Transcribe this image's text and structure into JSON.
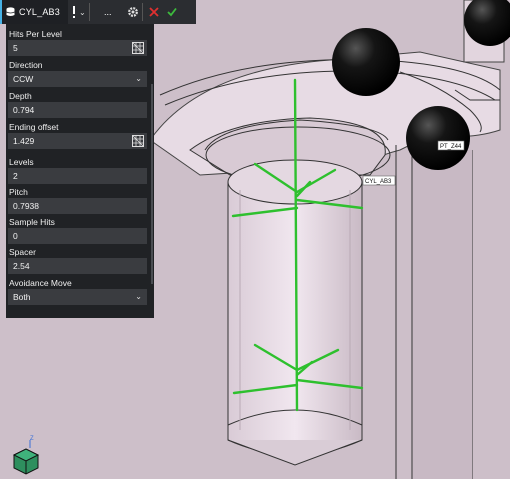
{
  "toolbar": {
    "feature_name": "CYL_AB3",
    "more_label": "...",
    "icons": [
      "database-icon",
      "exclamation-icon",
      "chevron-down-icon",
      "gear-icon",
      "close-icon",
      "check-icon"
    ],
    "colors": {
      "accent": "#47b2e6",
      "cancel": "#e03030",
      "confirm": "#3dbb3d"
    }
  },
  "panel": {
    "fields": [
      {
        "label": "Hits Per Level",
        "value": "5",
        "kind": "input-picker"
      },
      {
        "label": "Direction",
        "value": "CCW",
        "kind": "select"
      },
      {
        "label": "Depth",
        "value": "0.794",
        "kind": "input"
      },
      {
        "label": "Ending offset",
        "value": "1.429",
        "kind": "input-picker"
      },
      {
        "label": "Levels",
        "value": "2",
        "kind": "input"
      },
      {
        "label": "Pitch",
        "value": "0.7938",
        "kind": "input"
      },
      {
        "label": "Sample Hits",
        "value": "0",
        "kind": "input"
      },
      {
        "label": "Spacer",
        "value": "2.54",
        "kind": "input"
      },
      {
        "label": "Avoidance Move",
        "value": "Both",
        "kind": "select"
      }
    ]
  },
  "viewport": {
    "labels": {
      "cylinder": "CYL_AB3",
      "point": "PT_Z44"
    },
    "colors": {
      "background": "#cdbfc9",
      "part": "#e6d9e2",
      "hits": "#2ec02e",
      "fixture": "#0b0b0b"
    },
    "axis": {
      "z_label": "Z"
    }
  }
}
